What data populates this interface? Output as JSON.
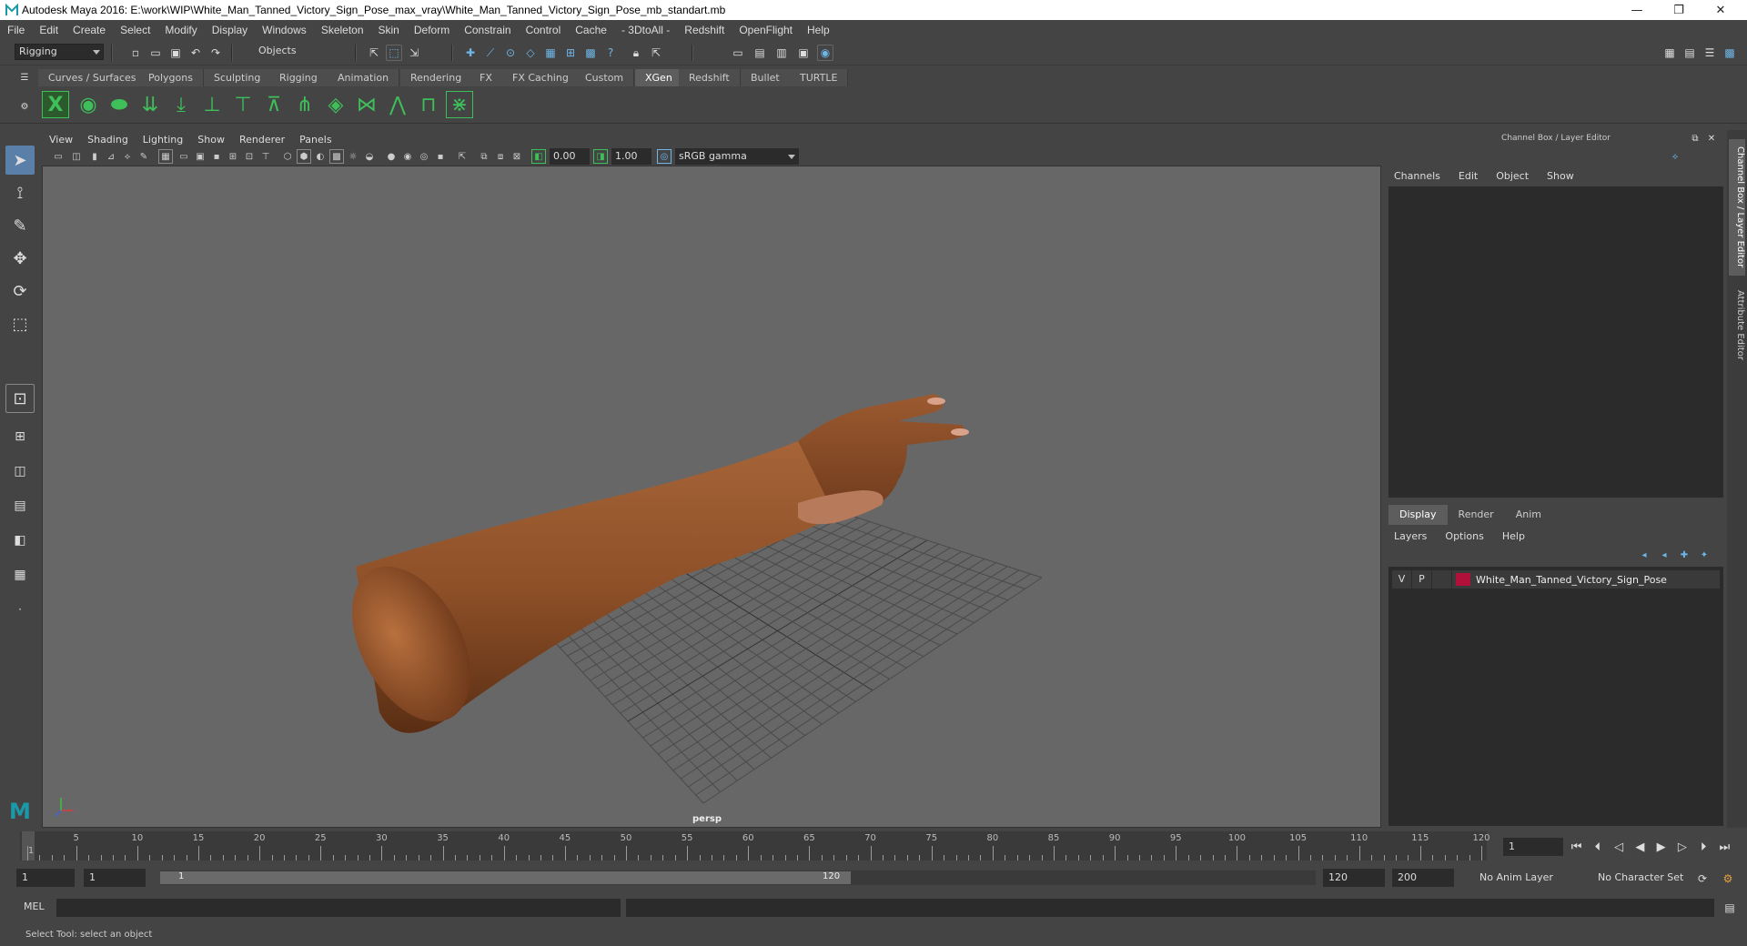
{
  "window": {
    "title": "Autodesk Maya 2016: E:\\work\\WIP\\White_Man_Tanned_Victory_Sign_Pose_max_vray\\White_Man_Tanned_Victory_Sign_Pose_mb_standart.mb",
    "minimize": "—",
    "maximize": "❐",
    "close": "✕"
  },
  "menubar": [
    "File",
    "Edit",
    "Create",
    "Select",
    "Modify",
    "Display",
    "Windows",
    "Skeleton",
    "Skin",
    "Deform",
    "Constrain",
    "Control",
    "Cache",
    "- 3DtoAll -",
    "Redshift",
    "OpenFlight",
    "Help"
  ],
  "statusline": {
    "menuset": "Rigging",
    "selection_mode": "Objects"
  },
  "shelf_tabs": [
    "Curves / Surfaces",
    "Polygons",
    "Sculpting",
    "Rigging",
    "Animation",
    "Rendering",
    "FX",
    "FX Caching",
    "Custom",
    "XGen",
    "Redshift",
    "Bullet",
    "TURTLE"
  ],
  "shelf_active_tab": "XGen",
  "viewport": {
    "menu": [
      "View",
      "Shading",
      "Lighting",
      "Show",
      "Renderer",
      "Panels"
    ],
    "exposure": "0.00",
    "gamma": "1.00",
    "color_space": "sRGB gamma",
    "camera": "persp"
  },
  "right_panel": {
    "title": "Channel Box / Layer Editor",
    "channel_menu": [
      "Channels",
      "Edit",
      "Object",
      "Show"
    ],
    "layer_tabs": [
      "Display",
      "Render",
      "Anim"
    ],
    "layer_menu": [
      "Layers",
      "Options",
      "Help"
    ],
    "layer": {
      "visible": "V",
      "playback": "P",
      "name": "White_Man_Tanned_Victory_Sign_Pose",
      "color": "#b0103a"
    },
    "side_tabs": [
      "Channel Box / Layer Editor",
      "Attribute Editor"
    ]
  },
  "timeline": {
    "ticks": [
      1,
      5,
      10,
      15,
      20,
      25,
      30,
      35,
      40,
      45,
      50,
      55,
      60,
      65,
      70,
      75,
      80,
      85,
      90,
      95,
      100,
      105,
      110,
      115,
      120
    ],
    "start": 1,
    "end": 120,
    "current_frame": "1"
  },
  "range": {
    "anim_start": "1",
    "playback_start": "1",
    "range_start_label": "1",
    "range_end_label": "120",
    "playback_end": "120",
    "anim_end": "200",
    "anim_layer": "No Anim Layer",
    "character_set": "No Character Set"
  },
  "cmdline": {
    "label": "MEL"
  },
  "helpline": {
    "text": "Select Tool: select an object"
  }
}
